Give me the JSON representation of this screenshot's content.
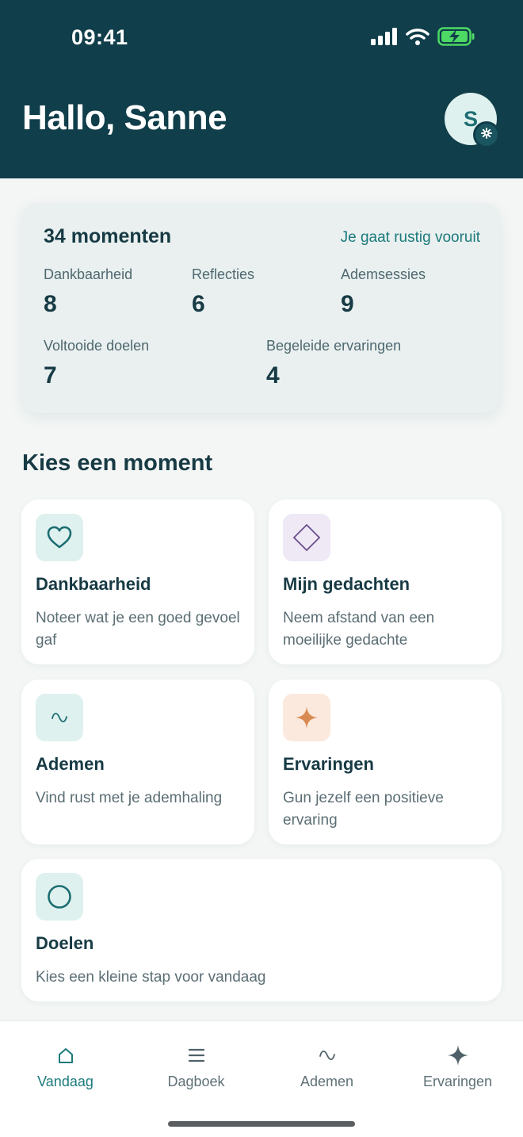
{
  "status_bar": {
    "time": "09:41"
  },
  "header": {
    "greeting": "Hallo, Sanne",
    "avatar_initial": "S"
  },
  "stats": {
    "total": "34 momenten",
    "subtitle": "Je gaat rustig vooruit",
    "items": [
      {
        "label": "Dankbaarheid",
        "value": "8"
      },
      {
        "label": "Reflecties",
        "value": "6"
      },
      {
        "label": "Ademsessies",
        "value": "9"
      },
      {
        "label": "Voltooide doelen",
        "value": "7"
      },
      {
        "label": "Begeleide ervaringen",
        "value": "4"
      }
    ]
  },
  "section_title": "Kies een moment",
  "tiles": [
    {
      "title": "Dankbaarheid",
      "description": "Noteer wat je een goed gevoel gaf",
      "icon": "heart-icon"
    },
    {
      "title": "Mijn gedachten",
      "description": "Neem afstand van een moeilijke gedachte",
      "icon": "diamond-icon"
    },
    {
      "title": "Ademen",
      "description": "Vind rust met je ademhaling",
      "icon": "wave-icon"
    },
    {
      "title": "Ervaringen",
      "description": "Gun jezelf een positieve ervaring",
      "icon": "sparkle-icon"
    },
    {
      "title": "Doelen",
      "description": "Kies een kleine stap voor vandaag",
      "icon": "circle-icon"
    }
  ],
  "tabs": [
    {
      "label": "Vandaag",
      "icon": "home-icon",
      "active": true
    },
    {
      "label": "Dagboek",
      "icon": "list-icon",
      "active": false
    },
    {
      "label": "Ademen",
      "icon": "wave-icon",
      "active": false
    },
    {
      "label": "Ervaringen",
      "icon": "sparkle-icon",
      "active": false
    }
  ],
  "colors": {
    "header_bg": "#103e4a",
    "accent": "#1c7a7c",
    "teal_tint": "#dff1ef",
    "purple_tint": "#efe9f6",
    "orange_tint": "#fbe9dd",
    "orange_accent": "#d98a52"
  }
}
